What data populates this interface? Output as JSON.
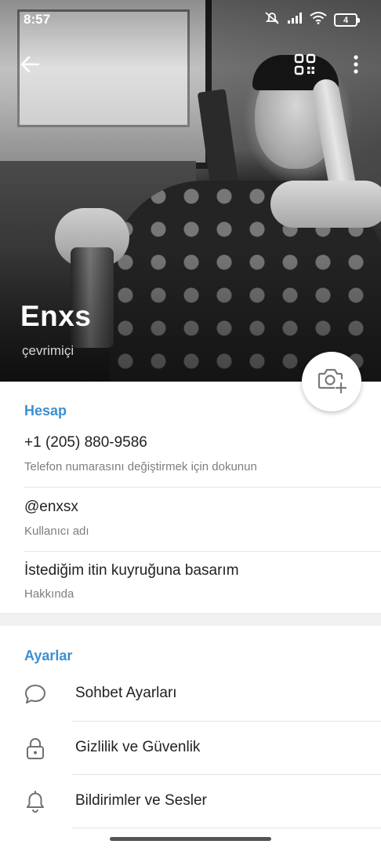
{
  "status_bar": {
    "time": "8:57",
    "battery": "4",
    "icons": [
      "muted-icon",
      "signal-icon",
      "wifi-icon",
      "battery-icon"
    ]
  },
  "top_bar": {
    "back_icon": "arrow-left-icon",
    "qr_icon": "qr-code-icon",
    "more_icon": "more-vertical-icon"
  },
  "profile": {
    "name": "Enxs",
    "status": "çevrimiçi",
    "camera_icon": "camera-add-icon"
  },
  "account": {
    "section_title": "Hesap",
    "phone": "+1 (205) 880-9586",
    "phone_hint": "Telefon numarasını değiştirmek için dokunun",
    "username": "@enxsx",
    "username_hint": "Kullanıcı adı",
    "bio": "İstediğim itin kuyruğuna basarım",
    "bio_hint": "Hakkında"
  },
  "settings": {
    "section_title": "Ayarlar",
    "items": [
      {
        "label": "Sohbet Ayarları",
        "icon": "chat-bubble-icon"
      },
      {
        "label": "Gizlilik ve Güvenlik",
        "icon": "lock-icon"
      },
      {
        "label": "Bildirimler ve Sesler",
        "icon": "bell-icon"
      }
    ]
  },
  "colors": {
    "accent": "#3b8fd0",
    "text_primary": "#222222",
    "text_secondary": "#7e7e7e"
  }
}
